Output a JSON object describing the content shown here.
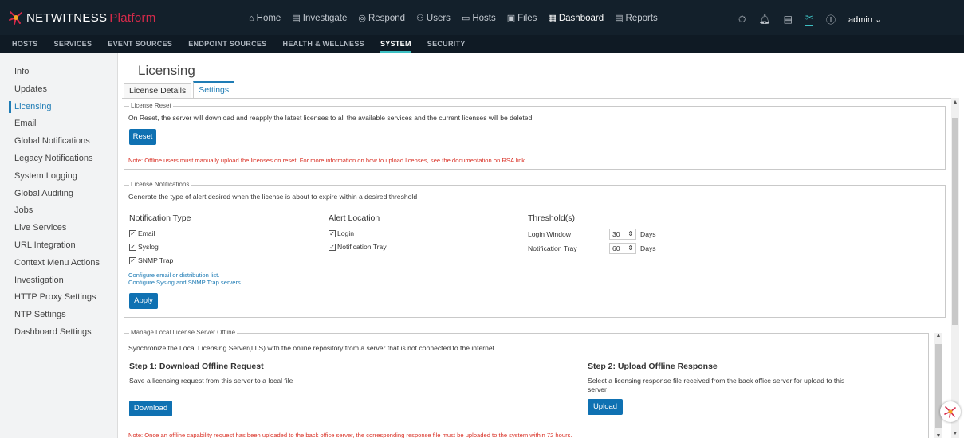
{
  "brand": {
    "name": "NETWITNESS",
    "platform": "Platform"
  },
  "main_nav": [
    {
      "label": "Home",
      "icon": "home-icon"
    },
    {
      "label": "Investigate",
      "icon": "investigate-icon"
    },
    {
      "label": "Respond",
      "icon": "respond-icon"
    },
    {
      "label": "Users",
      "icon": "users-icon"
    },
    {
      "label": "Hosts",
      "icon": "hosts-icon"
    },
    {
      "label": "Files",
      "icon": "files-icon"
    },
    {
      "label": "Dashboard",
      "icon": "dashboard-icon"
    },
    {
      "label": "Reports",
      "icon": "reports-icon"
    }
  ],
  "user": {
    "name": "admin"
  },
  "sub_nav": [
    "HOSTS",
    "SERVICES",
    "EVENT SOURCES",
    "ENDPOINT SOURCES",
    "HEALTH & WELLNESS",
    "SYSTEM",
    "SECURITY"
  ],
  "sidebar": [
    "Info",
    "Updates",
    "Licensing",
    "Email",
    "Global Notifications",
    "Legacy Notifications",
    "System Logging",
    "Global Auditing",
    "Jobs",
    "Live Services",
    "URL Integration",
    "Context Menu Actions",
    "Investigation",
    "HTTP Proxy Settings",
    "NTP Settings",
    "Dashboard Settings"
  ],
  "page": {
    "title": "Licensing",
    "tabs": [
      "License Details",
      "Settings"
    ]
  },
  "license_reset": {
    "legend": "License Reset",
    "description": "On Reset, the server will download and reapply the latest licenses to all the available services and the current licenses will be deleted.",
    "button": "Reset",
    "note": "Note: Offline users must manually upload the licenses on reset. For more information on how to upload licenses, see the documentation on RSA link."
  },
  "license_notifications": {
    "legend": "License Notifications",
    "description": "Generate the type of alert desired when the license is about to expire within a desired threshold",
    "col_type": "Notification Type",
    "col_location": "Alert Location",
    "col_threshold": "Threshold(s)",
    "types": [
      "Email",
      "Syslog",
      "SNMP Trap"
    ],
    "locations": [
      "Login",
      "Notification Tray"
    ],
    "thresholds": [
      {
        "label": "Login Window",
        "value": "30",
        "unit": "Days"
      },
      {
        "label": "Notification Tray",
        "value": "60",
        "unit": "Days"
      }
    ],
    "link1": "Configure email or distribution list.",
    "link2": "Configure Syslog and SNMP Trap servers.",
    "button": "Apply"
  },
  "lls_offline": {
    "legend": "Manage Local License Server Offline",
    "description": "Synchronize the Local Licensing Server(LLS) with the online repository from a server that is not connected to the internet",
    "step1_title": "Step 1: Download Offline Request",
    "step1_desc": "Save a licensing request from this server to a local file",
    "step1_button": "Download",
    "step2_title": "Step 2: Upload Offline Response",
    "step2_desc": "Select a licensing response file received from the back office server for upload to this server",
    "step2_button": "Upload",
    "note": "Note: Once an offline capability request has been uploaded to the back office server, the corresponding response file must be uploaded to the system within 72 hours."
  }
}
